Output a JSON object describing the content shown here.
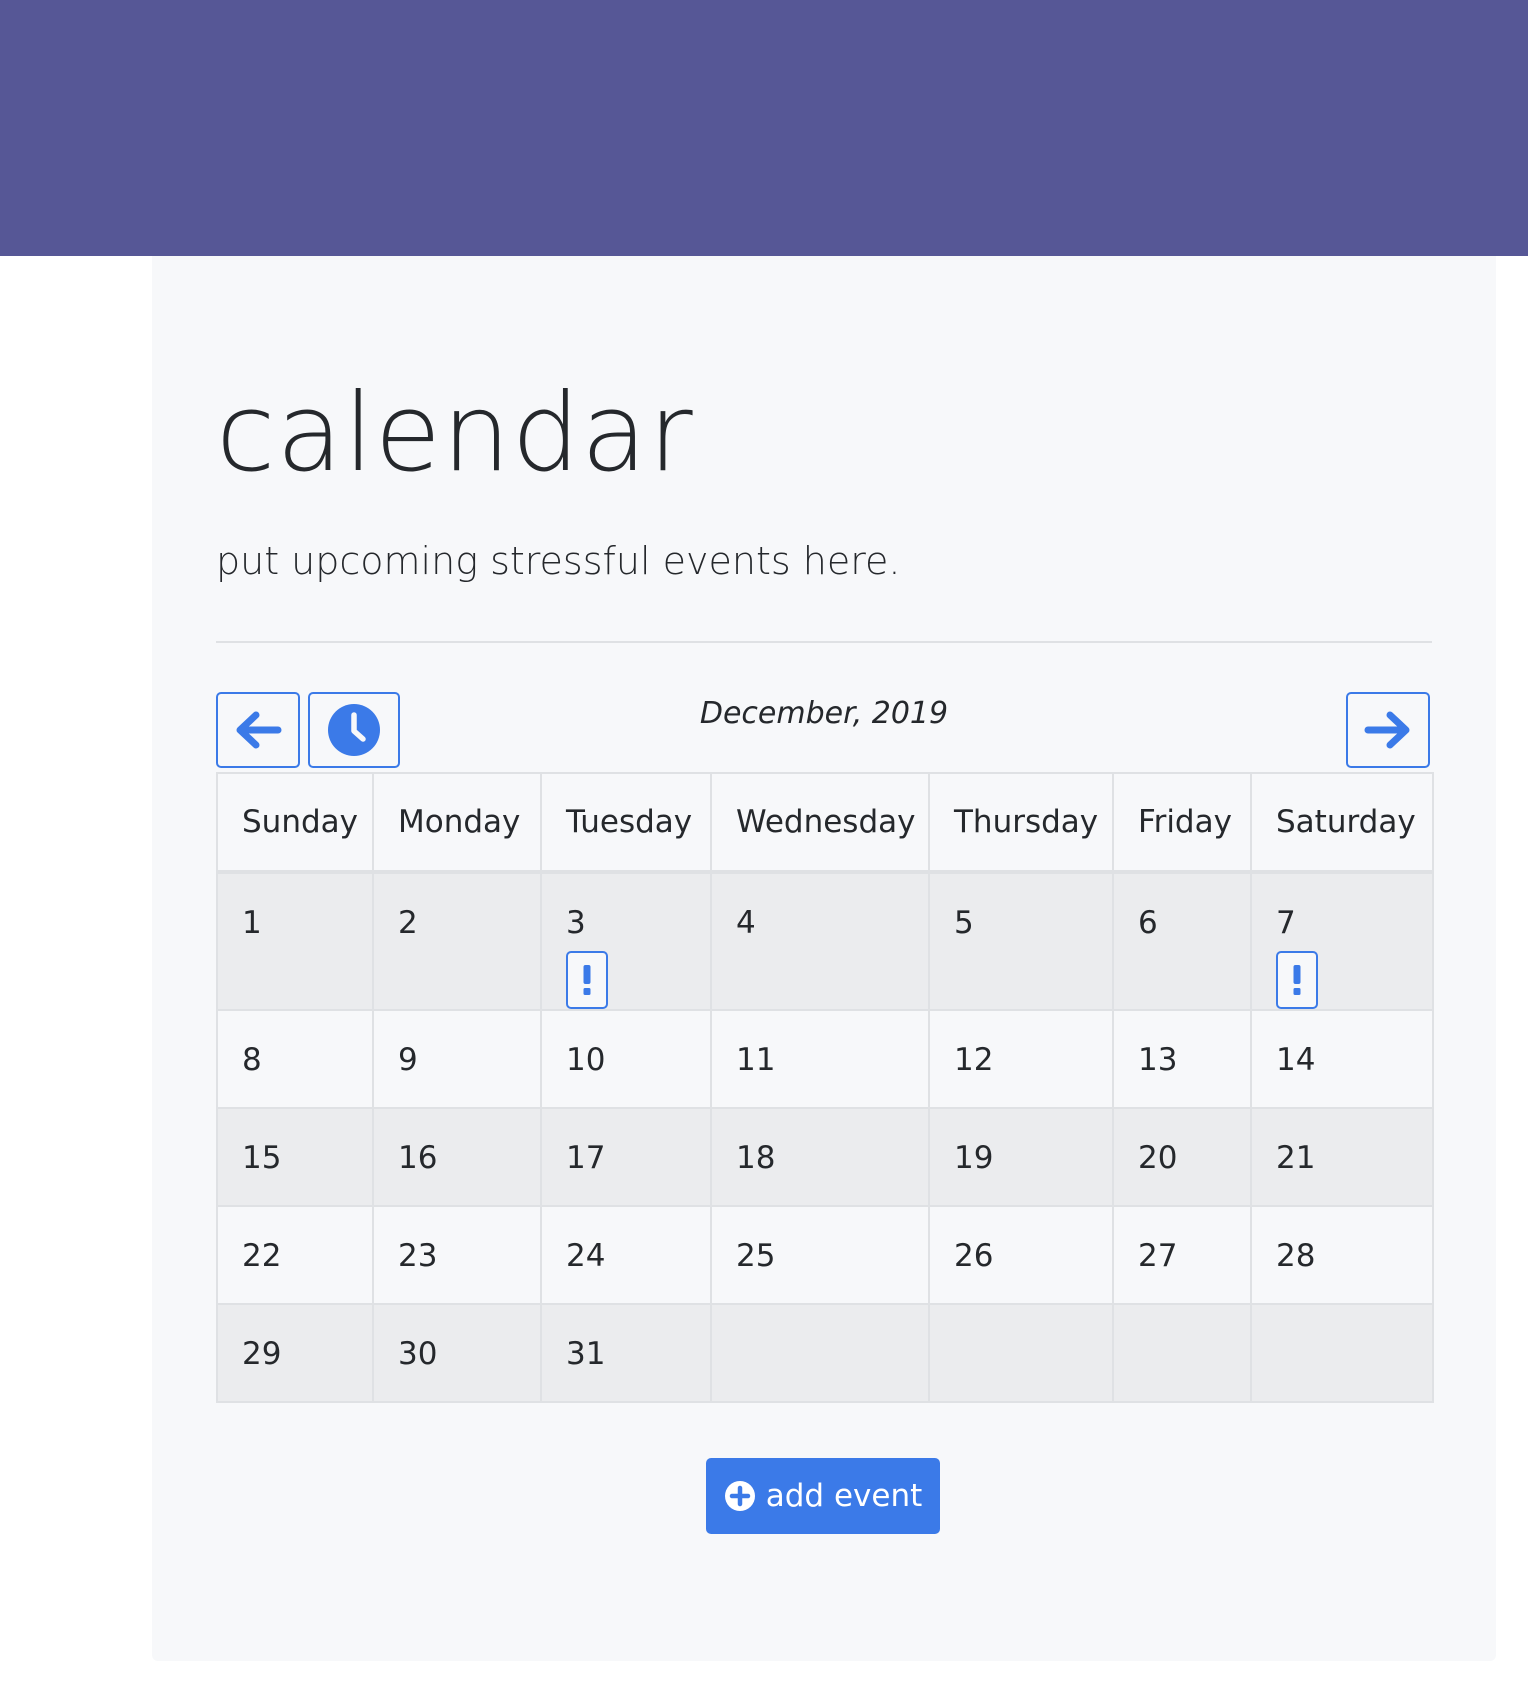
{
  "header": {
    "title": "calendar",
    "subtitle": "put upcoming stressful events here."
  },
  "nav": {
    "month_label": "December, 2019",
    "prev_icon": "arrow-left-icon",
    "today_icon": "clock-icon",
    "next_icon": "arrow-right-icon"
  },
  "weekdays": [
    "Sunday",
    "Monday",
    "Tuesday",
    "Wednesday",
    "Thursday",
    "Friday",
    "Saturday"
  ],
  "weeks": [
    [
      "1",
      "2",
      "3",
      "4",
      "5",
      "6",
      "7"
    ],
    [
      "8",
      "9",
      "10",
      "11",
      "12",
      "13",
      "14"
    ],
    [
      "15",
      "16",
      "17",
      "18",
      "19",
      "20",
      "21"
    ],
    [
      "22",
      "23",
      "24",
      "25",
      "26",
      "27",
      "28"
    ],
    [
      "29",
      "30",
      "31",
      "",
      "",
      "",
      ""
    ]
  ],
  "event_days": [
    "3",
    "7"
  ],
  "event_icon": "exclamation-icon",
  "add_button": {
    "label": "add event",
    "icon": "plus-circle-icon"
  },
  "colors": {
    "banner": "#565796",
    "accent": "#3b7ae8",
    "card": "#f7f8fa"
  }
}
